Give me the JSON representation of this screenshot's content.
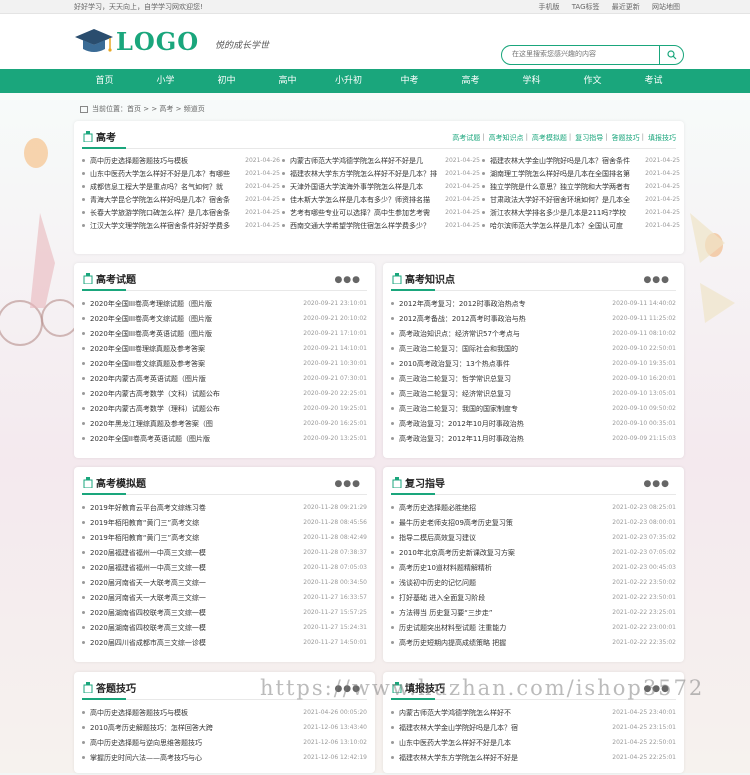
{
  "topbar": {
    "welcome": "好好学习，天天向上，自学学习网欢迎您!",
    "links": [
      "手机版",
      "TAG标签",
      "最近更新",
      "网站地图"
    ]
  },
  "header": {
    "logo_text": "LOGO",
    "slogan": "悦的成长学世",
    "search_placeholder": "在这里搜索您感兴趣的内容"
  },
  "nav": [
    "首页",
    "小学",
    "初中",
    "高中",
    "小升初",
    "中考",
    "高考",
    "学科",
    "作文",
    "考试"
  ],
  "breadcrumb": "当前位置：首页 > > 高考 > 频道页",
  "main": {
    "title": "高考",
    "tabs": [
      "高考试题",
      "高考知识点",
      "高考模拟题",
      "复习指导",
      "答题技巧",
      "填报技巧"
    ],
    "cols": [
      [
        {
          "t": "高中历史选择题答题技巧与模板",
          "d": "2021-04-26"
        },
        {
          "t": "山东中医药大学怎么样好不好是几本？有哪些",
          "d": "2021-04-25"
        },
        {
          "t": "成都信息工程大学是重点吗？名气如何？就",
          "d": "2021-04-25"
        },
        {
          "t": "青海大学昆仑学院怎么样好吗是几本？宿舍条",
          "d": "2021-04-25"
        },
        {
          "t": "长春大学旅游学院口碑怎么样？是几本宿舍条",
          "d": "2021-04-25"
        },
        {
          "t": "江汉大学文理学院怎么样宿舍条件好好学费多",
          "d": "2021-04-25"
        }
      ],
      [
        {
          "t": "内蒙古师范大学鸿德学院怎么样好不好是几",
          "d": "2021-04-25"
        },
        {
          "t": "福建农林大学东方学院怎么样好不好是几本？排",
          "d": "2021-04-25"
        },
        {
          "t": "天津外国语大学滨海外事学院怎么样是几本",
          "d": "2021-04-25"
        },
        {
          "t": "佳木斯大学怎么样是几本有多少？师资排名描",
          "d": "2021-04-25"
        },
        {
          "t": "艺考有哪些专业可以选择？高中生参加艺考需",
          "d": "2021-04-25"
        },
        {
          "t": "西南交通大学希望学院住宿怎么样学费多少？",
          "d": "2021-04-25"
        }
      ],
      [
        {
          "t": "福建农林大学金山学院好吗是几本？宿舍条件",
          "d": "2021-04-25"
        },
        {
          "t": "湖南理工学院怎么样好吗是几本在全国排名第",
          "d": "2021-04-25"
        },
        {
          "t": "独立学院是什么意思？独立学院和大学两者有",
          "d": "2021-04-25"
        },
        {
          "t": "甘肃政法大学好不好宿舍环境如何？是几本全",
          "d": "2021-04-25"
        },
        {
          "t": "浙江农林大学排名多少是几本是211吗?学校",
          "d": "2021-04-25"
        },
        {
          "t": "哈尔滨师范大学怎么样是几本？全国认可度",
          "d": "2021-04-25"
        }
      ]
    ]
  },
  "panels": [
    {
      "title": "高考试题",
      "more": "●●●",
      "items": [
        {
          "t": "2020年全国III卷高考理综试题（图片版",
          "d": "2020-09-21 23:10:01"
        },
        {
          "t": "2020年全国III卷高考文综试题（图片版",
          "d": "2020-09-21 20:10:02"
        },
        {
          "t": "2020年全国III卷高考英语试题（图片版",
          "d": "2020-09-21 17:10:01"
        },
        {
          "t": "2020年全国III卷理综真题及参考答案",
          "d": "2020-09-21 14:10:01"
        },
        {
          "t": "2020年全国III卷文综真题及参考答案",
          "d": "2020-09-21 10:30:01"
        },
        {
          "t": "2020年内蒙古高考英语试题（图片版",
          "d": "2020-09-21 07:30:01"
        },
        {
          "t": "2020年内蒙古高考数学（文科）试题公布",
          "d": "2020-09-20 22:25:01"
        },
        {
          "t": "2020年内蒙古高考数学（理科）试题公布",
          "d": "2020-09-20 19:25:01"
        },
        {
          "t": "2020年黑龙江理综真题及参考答案（图",
          "d": "2020-09-20 16:25:01"
        },
        {
          "t": "2020年全国II卷高考英语试题（图片版",
          "d": "2020-09-20 13:25:01"
        }
      ]
    },
    {
      "title": "高考知识点",
      "more": "●●●",
      "items": [
        {
          "t": "2012年高考复习：2012时事政治热点专",
          "d": "2020-09-11 14:40:02"
        },
        {
          "t": "2012高考备战：2012高考时事政治与热",
          "d": "2020-09-11 11:25:02"
        },
        {
          "t": "高考政治知识点：经济常识57个考点与",
          "d": "2020-09-11 08:10:02"
        },
        {
          "t": "高三政治二轮复习：国际社会和我国的",
          "d": "2020-09-10 22:50:01"
        },
        {
          "t": "2010高考政治复习：13个热点事件",
          "d": "2020-09-10 19:35:01"
        },
        {
          "t": "高三政治二轮复习：哲学常识总复习",
          "d": "2020-09-10 16:20:01"
        },
        {
          "t": "高三政治二轮复习：经济常识总复习",
          "d": "2020-09-10 13:05:01"
        },
        {
          "t": "高三政治二轮复习：我国的国家制度专",
          "d": "2020-09-10 09:50:02"
        },
        {
          "t": "高考政治复习：2012年10月时事政治热",
          "d": "2020-09-10 00:35:01"
        },
        {
          "t": "高考政治复习：2012年11月时事政治热",
          "d": "2020-09-09 21:15:03"
        }
      ]
    },
    {
      "title": "高考模拟题",
      "more": "●●●",
      "items": [
        {
          "t": "2019年好教育云平台高考文综练习卷",
          "d": "2020-11-28 09:21:29"
        },
        {
          "t": "2019年栢阳教育“黄门三”高考文综",
          "d": "2020-11-28 08:45:56"
        },
        {
          "t": "2019年栢阳教育“黄门三”高考文综",
          "d": "2020-11-28 08:42:49"
        },
        {
          "t": "2020届福建省福州一中高三文综一模",
          "d": "2020-11-28 07:38:37"
        },
        {
          "t": "2020届福建省福州一中高三文综一模",
          "d": "2020-11-28 07:05:03"
        },
        {
          "t": "2020届河南省天一大联考高三文综一",
          "d": "2020-11-28 00:34:50"
        },
        {
          "t": "2020届河南省天一大联考高三文综一",
          "d": "2020-11-27 16:33:57"
        },
        {
          "t": "2020届湖南省四校联考高三文综一模",
          "d": "2020-11-27 15:57:25"
        },
        {
          "t": "2020届湖南省四校联考高三文综一模",
          "d": "2020-11-27 15:24:31"
        },
        {
          "t": "2020届四川省成都市高三文综一诊模",
          "d": "2020-11-27 14:50:01"
        }
      ]
    },
    {
      "title": "复习指导",
      "more": "●●●",
      "items": [
        {
          "t": "高考历史选择题必胜绝招",
          "d": "2021-02-23 08:25:01"
        },
        {
          "t": "最牛历史老师支招09高考历史复习策",
          "d": "2021-02-23 08:00:01"
        },
        {
          "t": "指导二模后高效复习建议",
          "d": "2021-02-23 07:35:02"
        },
        {
          "t": "2010年北京高考历史新课改复习方案",
          "d": "2021-02-23 07:05:02"
        },
        {
          "t": "高考历史10道材料题精解精析",
          "d": "2021-02-23 00:45:03"
        },
        {
          "t": "浅谈初中历史的记忆问题",
          "d": "2021-02-22 23:50:02"
        },
        {
          "t": "打好基础 进入全面复习阶段",
          "d": "2021-02-22 23:50:01"
        },
        {
          "t": "方法得当 历史复习要“三步走”",
          "d": "2021-02-22 23:25:01"
        },
        {
          "t": "历史试题突出材料型试题 注重能力",
          "d": "2021-02-22 23:00:01"
        },
        {
          "t": "高考历史短期内提高成绩策略 把握",
          "d": "2021-02-22 22:35:02"
        }
      ]
    },
    {
      "title": "答题技巧",
      "more": "●●●",
      "items": [
        {
          "t": "高中历史选择题答题技巧与模板",
          "d": "2021-04-26 00:05:20"
        },
        {
          "t": "2010高考历史解题技巧：怎样回答大跨",
          "d": "2021-12-06 13:43:40"
        },
        {
          "t": "高中历史选择题与逆向思维答题技巧",
          "d": "2021-12-06 13:10:02"
        },
        {
          "t": "掌握历史时间六法——高考技巧与心",
          "d": "2021-12-06 12:42:19"
        }
      ]
    },
    {
      "title": "填报技巧",
      "more": "●●●",
      "items": [
        {
          "t": "内蒙古师范大学鸿德学院怎么样好不",
          "d": "2021-04-25 23:40:01"
        },
        {
          "t": "福建农林大学金山学院好吗是几本？宿",
          "d": "2021-04-25 23:15:01"
        },
        {
          "t": "山东中医药大学怎么样好不好是几本",
          "d": "2021-04-25 22:50:01"
        },
        {
          "t": "福建农林大学东方学院怎么样好不好是",
          "d": "2021-04-25 22:25:01"
        }
      ]
    }
  ],
  "watermark": "https://www.huzhan.com/ishop3572"
}
